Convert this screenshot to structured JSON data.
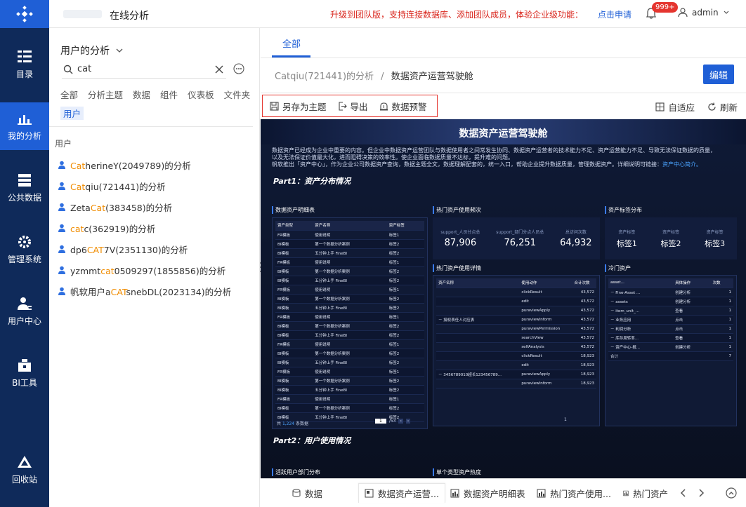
{
  "nav": {
    "items": [
      {
        "label": "目录",
        "icon": "catalog-icon"
      },
      {
        "label": "我的分析",
        "icon": "analysis-icon"
      },
      {
        "label": "公共数据",
        "icon": "database-icon"
      },
      {
        "label": "管理系统",
        "icon": "gear-icon"
      },
      {
        "label": "用户中心",
        "icon": "user-center-icon"
      },
      {
        "label": "BI工具",
        "icon": "toolbox-icon"
      },
      {
        "label": "回收站",
        "icon": "recycle-icon"
      }
    ]
  },
  "topbar": {
    "title": "在线分析",
    "promo": "升级到团队版，支持连接数据库、添加团队成员，体验企业级功能：",
    "apply": "点击申请",
    "badge": "999+",
    "user": "admin"
  },
  "side": {
    "title": "用户的分析",
    "search_value": "cat",
    "filters": [
      "全部",
      "分析主题",
      "数据",
      "组件",
      "仪表板",
      "文件夹",
      "用户"
    ],
    "active_filter": "用户",
    "section": "用户",
    "results": [
      {
        "pre": "",
        "hl": "Cat",
        "post": "herineY(2049789)的分析"
      },
      {
        "pre": "",
        "hl": "Cat",
        "post": "qiu(721441)的分析"
      },
      {
        "pre": "Zeta",
        "hl": "Cat",
        "post": "(383458)的分析"
      },
      {
        "pre": "",
        "hl": "cat",
        "post": "c(362919)的分析"
      },
      {
        "pre": "dp6",
        "hl": "CAT",
        "post": "7V(2351130)的分析"
      },
      {
        "pre": "yzmmt",
        "hl": "cat",
        "post": "0509297(1855856)的分析"
      },
      {
        "pre": "帆软用户a",
        "hl": "CAT",
        "post": "snebDL(2023134)的分析"
      }
    ]
  },
  "main": {
    "tab": "全部",
    "crumb_parent": "Catqiu(721441)的分析",
    "crumb_sep": "/",
    "crumb_current": "数据资产运营驾驶舱",
    "edit": "编辑",
    "tools": {
      "save_as": "另存为主题",
      "export": "导出",
      "alert": "数据预警"
    },
    "fit": "自适应",
    "refresh": "刷新"
  },
  "dashboard": {
    "title": "数据资产运营驾驶舱",
    "intro1": "数据资产已经成为企业中重要的内容。但企业中数据资产运营团队与数据使用者之间常发生协同、数据资产运营者的技术能力不足、资产运营能力不足、导致无法保证数据的质量，",
    "intro2": "以及无法保证价值最大化，进而阻碍决策的效率性。使企业面临数据质量不达标，提升难的问题。",
    "intro3": "帆软推出「资产中心」，作为企业公司数据资产查询，数据主题全文，数据理解配套的，统一入口，帮助企业提升数据质量，管理数据资产。详细说明可链接：",
    "intro_link": "资产中心简介。",
    "part1": "Part1：资产分布情况",
    "part2": "Part2：用户使用情况",
    "p_detail": "数据资产明细表",
    "p_freq": "热门资产使用频次",
    "p_tags": "资产标签分布",
    "p_hotdetail": "热门资产使用详情",
    "p_cold": "冷门资产",
    "p_active": "活跃用户部门分布",
    "p_single": "单个类型资产热度",
    "kpi": [
      {
        "label": "support_人员分点总",
        "value": "87,906"
      },
      {
        "label": "support_部门分点人员总",
        "value": "76,251"
      },
      {
        "label": "总访问次数",
        "value": "64,932"
      }
    ],
    "tags": [
      {
        "label": "资产标签",
        "value": "标签1"
      },
      {
        "label": "资产标签",
        "value": "标签2"
      },
      {
        "label": "资产标签",
        "value": "标签3"
      }
    ],
    "detail_headers": [
      "资产类型",
      "资产名称",
      "资产标签"
    ],
    "detail_rows": [
      [
        "FR模板",
        "使用说明",
        "标签1"
      ],
      [
        "BI模板",
        "第一个数据分析案例",
        "标签2"
      ],
      [
        "BI模板",
        "五分钟上手 FineBI",
        "标签2"
      ],
      [
        "FR模板",
        "使用说明",
        "标签1"
      ],
      [
        "BI模板",
        "第一个数据分析案例",
        "标签2"
      ],
      [
        "BI模板",
        "五分钟上手 FineBI",
        "标签2"
      ],
      [
        "FR模板",
        "使用说明",
        "标签1"
      ],
      [
        "BI模板",
        "第一个数据分析案例",
        "标签2"
      ],
      [
        "BI模板",
        "五分钟上手 FineBI",
        "标签2"
      ],
      [
        "FR模板",
        "使用说明",
        "标签1"
      ],
      [
        "BI模板",
        "第一个数据分析案例",
        "标签2"
      ],
      [
        "BI模板",
        "五分钟上手 FineBI",
        "标签2"
      ],
      [
        "FR模板",
        "使用说明",
        "标签1"
      ],
      [
        "BI模板",
        "第一个数据分析案例",
        "标签2"
      ],
      [
        "BI模板",
        "五分钟上手 FineBI",
        "标签2"
      ],
      [
        "FR模板",
        "使用说明",
        "标签1"
      ],
      [
        "BI模板",
        "第一个数据分析案例",
        "标签2"
      ],
      [
        "BI模板",
        "五分钟上手 FineBI",
        "标签2"
      ],
      [
        "FR模板",
        "使用说明",
        "标签1"
      ],
      [
        "BI模板",
        "第一个数据分析案例",
        "标签2"
      ],
      [
        "BI模板",
        "五分钟上手 FineBI",
        "标签2"
      ]
    ],
    "detail_total_prefix": "共",
    "detail_total_num": "1,224",
    "detail_total_suffix": "条数据",
    "detail_page": "1",
    "detail_pages": "/53",
    "hot_headers": [
      "资产名称",
      "使用动作",
      "合计次数"
    ],
    "hot_group1": "授权表任人对应表",
    "hot_rows1": [
      [
        "clickResult",
        "43,572"
      ],
      [
        "edit",
        "43,572"
      ],
      [
        "puraviewApply",
        "43,572"
      ],
      [
        "puraviewInform",
        "43,572"
      ],
      [
        "puraviewPermission",
        "43,572"
      ],
      [
        "searchView",
        "43,572"
      ],
      [
        "selfAnalysis",
        "43,572"
      ]
    ],
    "hot_group2": "3456789010超长123456789...",
    "hot_rows2": [
      [
        "clickResult",
        "18,923"
      ],
      [
        "edit",
        "18,923"
      ],
      [
        "puraviewApply",
        "18,923"
      ],
      [
        "puraviewInform",
        "18,923"
      ]
    ],
    "hot_page": "1",
    "cold_headers": [
      "asset...",
      "具体操作",
      "次数"
    ],
    "cold_rows": [
      [
        "Fine-Asset ...",
        "创建分析",
        "1"
      ],
      [
        "assets",
        "创建分析",
        "1"
      ],
      [
        "item_unit_...",
        "查看",
        "1"
      ],
      [
        "业务应用",
        "点击",
        "1"
      ],
      [
        "利润分析",
        "点击",
        "1"
      ],
      [
        "库存周转率...",
        "查看",
        "1"
      ],
      [
        "资产中心-报...",
        "创建分析",
        "1"
      ]
    ],
    "cold_total_label": "合计",
    "cold_total_value": "7"
  },
  "bottom_tabs": [
    "数据",
    "数据资产运营...",
    "数据资产明细表",
    "热门资产使用...",
    "热门资产"
  ]
}
